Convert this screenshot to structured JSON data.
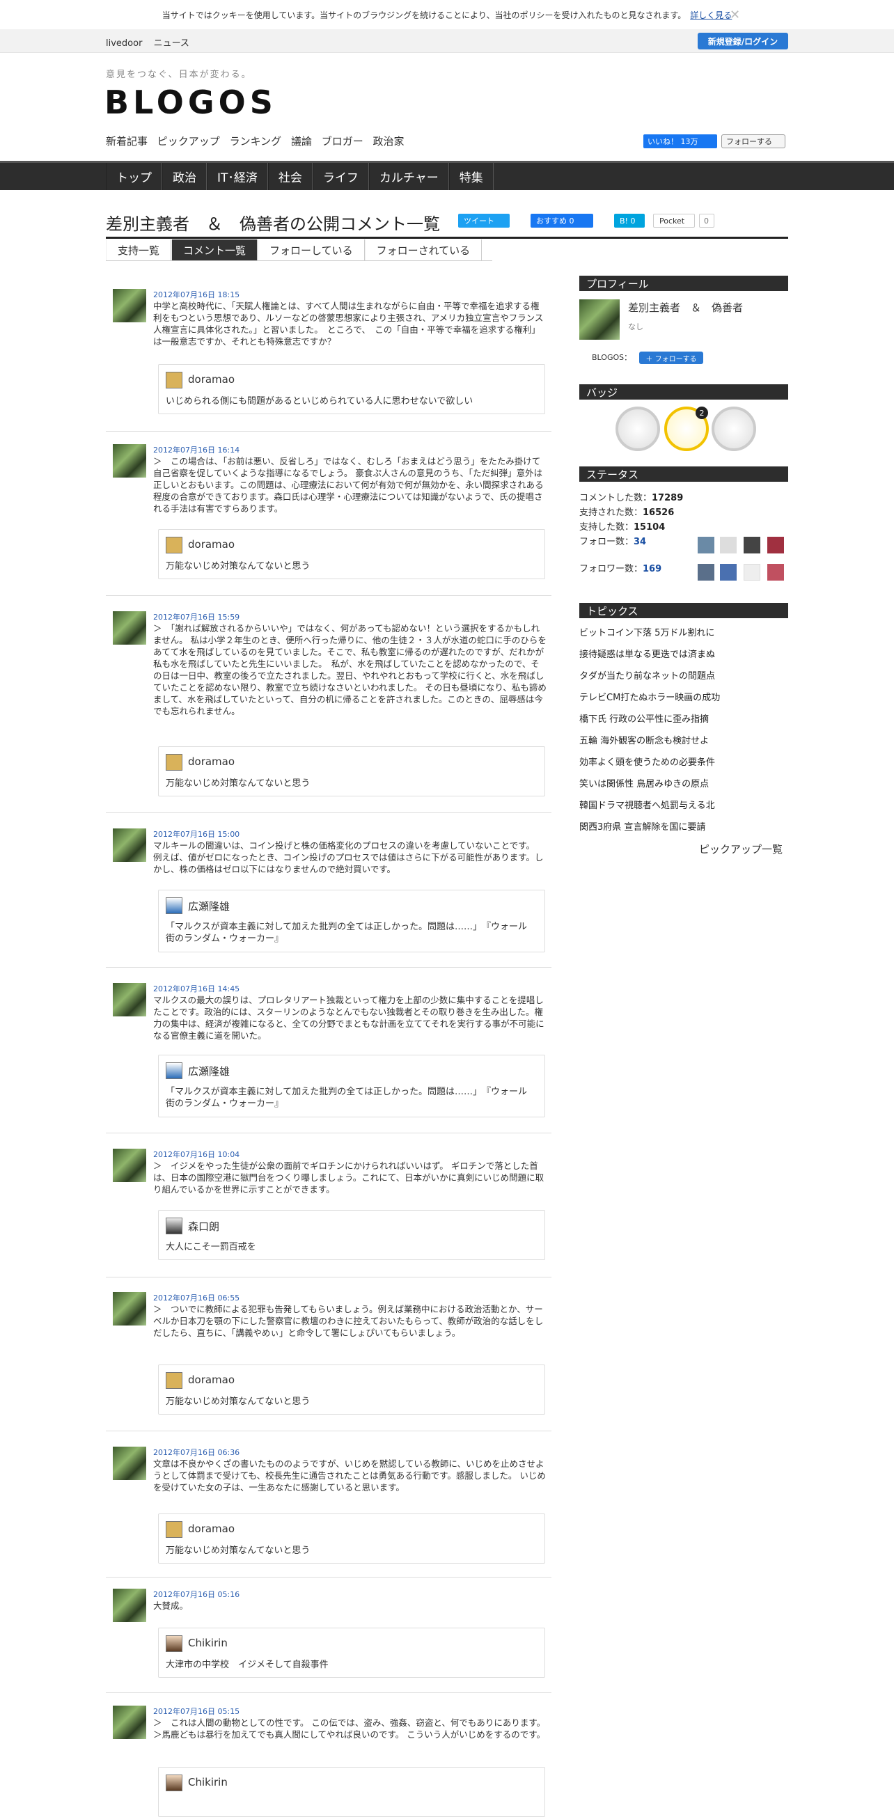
{
  "cookie": {
    "text": "当サイトではクッキーを使用しています。当サイトのブラウジングを続けることにより、当社のポリシーを受け入れたものと見なされます。",
    "more": "詳しく見る"
  },
  "topbar": {
    "links": [
      "livedoor",
      "ニュース"
    ],
    "login": "新規登録/ログイン"
  },
  "header": {
    "tagline": "意見をつなぐ、日本が変わる。",
    "logo": "BLOGOS",
    "subnav": [
      "新着記事",
      "ピックアップ",
      "ランキング",
      "議論",
      "ブロガー",
      "政治家"
    ],
    "fb_like": "いいね！ 13万",
    "tw_follow": "フォローする"
  },
  "mainnav": [
    "トップ",
    "政治",
    "IT･経済",
    "社会",
    "ライフ",
    "カルチャー",
    "特集"
  ],
  "page": {
    "title": "差別主義者　＆　偽善者の公開コメント一覧",
    "tweet": "ツイート",
    "fb": "おすすめ 0",
    "hb": "B! 0",
    "pocket": "Pocket",
    "pocket_count": "0"
  },
  "tabs": [
    "支持一覧",
    "コメント一覧",
    "フォローしている",
    "フォローされている"
  ],
  "comments": [
    {
      "date": "2012年07月16日 18:15",
      "text": "中学と高校時代に、「天賦人権論とは、すべて人間は生まれながらに自由・平等で幸福を追求する権利をもつという思想であり、ルソーなどの啓蒙思想家により主張され、アメリカ独立宣言やフランス人権宣言に具体化された。」と習いました。　ところで、　この「自由・平等で幸福を追求する権利」は一般意志ですか、それとも特殊意志ですか？",
      "rname": "doramao",
      "rtext": "いじめられる側にも問題があるといじめられている人に思わせないで欲しい"
    },
    {
      "date": "2012年07月16日 16:14",
      "text": "＞　この場合は、「お前は悪い、反省しろ」ではなく、むしろ「おまえはどう思う」をたたみ掛けて自己省察を促していくような指導になるでしょう。 豪食ぷ人さんの意見のうち、「ただ糾弾」意外は正しいとおもいます。この問題は、心理療法において何が有効で何が無効かを、永い間探求されある程度の合意ができております。森口氏は心理学・心理療法については知識がないようで、氏の提唱される手法は有害ですらあります。",
      "rname": "doramao",
      "rtext": "万能ないじめ対策なんてないと思う"
    },
    {
      "date": "2012年07月16日 15:59",
      "text": "＞　「謝れば解放されるからいいや」ではなく、何があっても認めない！という選択をするかもしれません。 私は小学２年生のとき、便所へ行った帰りに、他の生徒２・３人が水道の蛇口に手のひらをあてて水を飛ばしているのを見ていました。そこで、私も教室に帰るのが遅れたのですが、だれかが私も水を飛ばしていたと先生にいいました。　私が、水を飛ばしていたことを認めなかったので、その日は一日中、教室の後ろで立たされました。翌日、やれやれとおもって学校に行くと、水を飛ばしていたことを認めない限り、教室で立ち続けなさいといわれました。 その日も昼頃になり、私も諦めまして、水を飛ばしていたといって、自分の机に帰ることを許されました。このときの、屈辱感は今でも忘れられません。",
      "rname": "doramao",
      "rtext": "万能ないじめ対策なんてないと思う"
    },
    {
      "date": "2012年07月16日 15:00",
      "text": "マルキールの間違いは、コイン投げと株の価格変化のプロセスの違いを考慮していないことです。　例えば、値がゼロになったとき、コイン投げのプロセスでは値はさらに下がる可能性があります。しかし、株の価格はゼロ以下にはなりませんので絶対買いです。",
      "rname": "広瀬隆雄",
      "rtext": "「マルクスが資本主義に対して加えた批判の全ては正しかった。問題は……」　『ウォール街のランダム・ウォーカー』"
    },
    {
      "date": "2012年07月16日 14:45",
      "text": "マルクスの最大の誤りは、プロレタリアート独裁といって権力を上部の少数に集中することを提唱したことです。政治的には、スターリンのようなとんでもない独裁者とその取り巻きを生み出した。権力の集中は、経済が複雑になると、全ての分野でまともな計画を立ててそれを実行する事が不可能になる官僚主義に道を開いた。",
      "rname": "広瀬隆雄",
      "rtext": "「マルクスが資本主義に対して加えた批判の全ては正しかった。問題は……」　『ウォール街のランダム・ウォーカー』"
    },
    {
      "date": "2012年07月16日 10:04",
      "text": "＞　イジメをやった生徒が公衆の面前でギロチンにかけられればいいはず。 ギロチンで落とした首は、日本の国際空港に獄門台をつくり曝しましょう。これにて、日本がいかに真剣にいじめ問題に取り組んでいるかを世界に示すことができます。",
      "rname": "森口朗",
      "rtext": "大人にこそ一罰百戒を"
    },
    {
      "date": "2012年07月16日 06:55",
      "text": "＞　ついでに教師による犯罪も告発してもらいましょう。例えば業務中における政治活動とか、サーベルか日本刀を顎の下にした警察官に教壇のわきに控えておいたもらって、教師が政治的な話しをしだしたら、直ちに、「講義やめぃ」と命令して署にしょぴいてもらいましょう。",
      "rname": "doramao",
      "rtext": "万能ないじめ対策なんてないと思う"
    },
    {
      "date": "2012年07月16日 06:36",
      "text": "文章は不良かやくざの書いたもののようですが、いじめを黙認している教師に、いじめを止めさせようとして体罰まで受けても、校長先生に通告されたことは勇気ある行動です。感服しました。 いじめを受けていた女の子は、一生あなたに感謝していると思います。",
      "rname": "doramao",
      "rtext": "万能ないじめ対策なんてないと思う"
    },
    {
      "date": "2012年07月16日 05:16",
      "text": "大賛成。",
      "rname": "Chikirin",
      "rtext": "大津市の中学校　イジメそして自殺事件"
    },
    {
      "date": "2012年07月16日 05:15",
      "text": "＞　これは人間の動物としての性です。 この伝では、盗み、強姦、窃盗と、何でもありにあります。 ＞馬鹿どもは暴行を加えてでも真人間にしてやれば良いのです。 こういう人がいじめをするのです。",
      "rname": "Chikirin",
      "rtext": ""
    }
  ],
  "profile": {
    "header": "プロフィール",
    "name": "差別主義者　＆　偽善者",
    "desc": "なし",
    "blogos": "BLOGOS：",
    "follow": "フォローする"
  },
  "badges": {
    "header": "バッジ",
    "count": "2"
  },
  "status": {
    "header": "ステータス",
    "rows": [
      {
        "label": "コメントした数：",
        "value": "17289"
      },
      {
        "label": "支持された数：",
        "value": "16526"
      },
      {
        "label": "支持した数：",
        "value": "15104"
      },
      {
        "label": "フォロー数：",
        "value": "34"
      },
      {
        "label": "フォロワー数：",
        "value": "169"
      }
    ]
  },
  "topics": {
    "header": "トピックス",
    "items": [
      "ビットコイン下落 5万ドル割れに",
      "接待疑惑は単なる更迭では済まぬ",
      "タダが当たり前なネットの問題点",
      "テレビCM打たぬホラー映画の成功",
      "橋下氏 行政の公平性に歪み指摘",
      "五輪 海外観客の断念も検討せよ",
      "効率よく頭を使うための必要条件",
      "笑いは関係性 鳥居みゆきの原点",
      "韓国ドラマ視聴者へ処罰与える北",
      "関西3府県 宣言解除を国に要請"
    ],
    "all": "ピックアップ一覧"
  },
  "colors": {
    "accent": "#2a79d4",
    "nav": "#2d2d2d",
    "date": "#2a5db0"
  }
}
